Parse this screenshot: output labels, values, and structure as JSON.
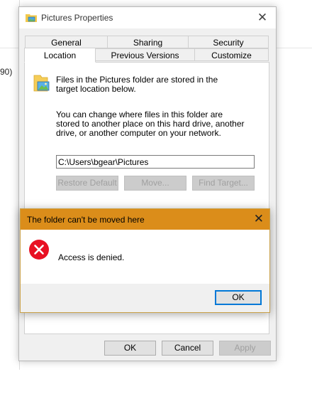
{
  "background": {
    "edge_text": "90)"
  },
  "window": {
    "title": "Pictures Properties",
    "close_glyph": "✕"
  },
  "tabs_row1": [
    "General",
    "Sharing",
    "Security"
  ],
  "tabs_row2": [
    "Location",
    "Previous Versions",
    "Customize"
  ],
  "location": {
    "description": "Files in the Pictures folder are stored in the target location below.",
    "help_text": "You can change where files in this folder are stored to another place on this hard drive, another drive, or another computer on your network.",
    "path_value": "C:\\Users\\bgear\\Pictures",
    "restore_default_label": "Restore Default",
    "move_label": "Move...",
    "find_target_label": "Find Target..."
  },
  "footer": {
    "ok_label": "OK",
    "cancel_label": "Cancel",
    "apply_label": "Apply"
  },
  "error_dialog": {
    "title": "The folder can't be moved here",
    "message": "Access is denied.",
    "ok_label": "OK",
    "close_glyph": "✕",
    "title_color": "#db8d1a",
    "icon_color": "#e81123"
  },
  "icons": {
    "title_icon": "folder-pictures-icon",
    "folder_icon": "pictures-folder-icon",
    "error_icon": "error-icon"
  }
}
